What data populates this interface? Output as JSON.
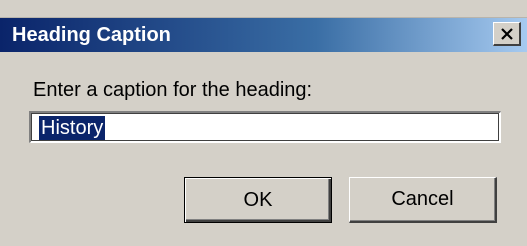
{
  "dialog": {
    "title": "Heading Caption",
    "close_label": "X",
    "prompt": "Enter a caption for the heading:",
    "input_value": "History",
    "ok_label": "OK",
    "cancel_label": "Cancel"
  },
  "colors": {
    "titlebar_start": "#0a246a",
    "titlebar_end": "#a6caf0",
    "dialog_face": "#d4d0c8",
    "selection": "#0a246a"
  }
}
